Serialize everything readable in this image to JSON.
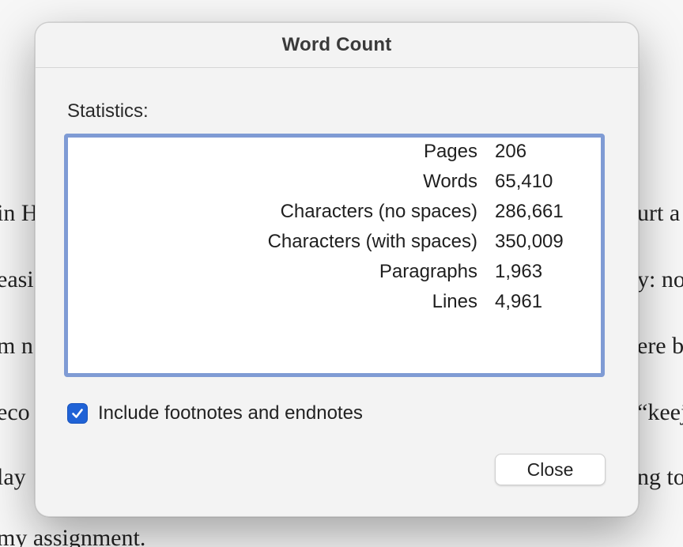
{
  "background_document": {
    "lines": [
      {
        "left": "in H",
        "right": "urt a"
      },
      {
        "left": "easi",
        "right": "y: no"
      },
      {
        "left": "m n",
        "right": "ere b"
      },
      {
        "left": "eco",
        "right": "“keej"
      },
      {
        "left": "lay",
        "right": "ng to"
      },
      {
        "left": "my assignment.",
        "right": ""
      }
    ]
  },
  "dialog": {
    "title": "Word Count",
    "statistics_label": "Statistics:",
    "stats": [
      {
        "label": "Pages",
        "value": "206"
      },
      {
        "label": "Words",
        "value": "65,410"
      },
      {
        "label": "Characters (no spaces)",
        "value": "286,661"
      },
      {
        "label": "Characters (with spaces)",
        "value": "350,009"
      },
      {
        "label": "Paragraphs",
        "value": "1,963"
      },
      {
        "label": "Lines",
        "value": "4,961"
      }
    ],
    "include_footnotes": {
      "label": "Include footnotes and endnotes",
      "checked": true
    },
    "close_label": "Close"
  },
  "colors": {
    "accent": "#1f62d6",
    "focus_ring": "#7f9bd4"
  }
}
